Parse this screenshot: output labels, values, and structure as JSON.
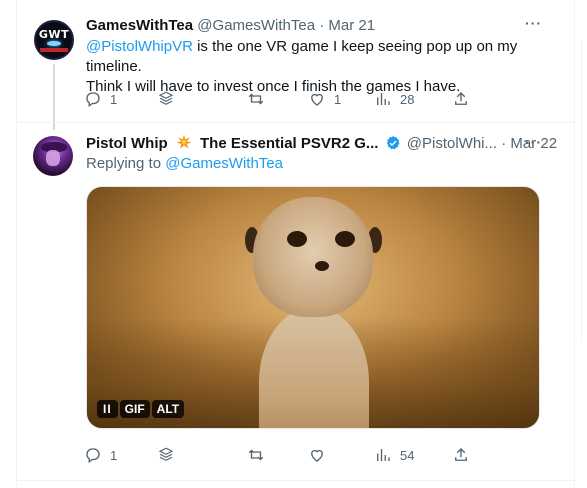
{
  "tweets": [
    {
      "name": "GamesWithTea",
      "handle": "@GamesWithTea",
      "dot": "·",
      "date": "Mar 21",
      "avatar_text": "GWT",
      "mention": "@PistolWhipVR",
      "text_line1_rest": " is the one VR game I keep seeing pop up on my timeline.",
      "text_line2": "Think I will have to invest once I finish the games I have.",
      "actions": {
        "replies": "1",
        "retweets": "",
        "likes": "1",
        "views": "28"
      }
    },
    {
      "name": "Pistol Whip",
      "name_suffix": "The Essential PSVR2 G...",
      "handle": "@PistolWhi...",
      "dot": "·",
      "date": "Mar 22",
      "replying_to_label": "Replying to ",
      "replying_to_handle": "@GamesWithTea",
      "media": {
        "pause": "II",
        "gif": "GIF",
        "alt": "ALT"
      },
      "actions": {
        "replies": "1",
        "retweets": "",
        "likes": "",
        "views": "54"
      }
    }
  ],
  "more_label": "···",
  "colors": {
    "accent": "#1d9bf0",
    "muted": "#536471",
    "text": "#0f1419",
    "divider": "#eff3f4"
  },
  "icons": [
    "reply-icon",
    "stack-icon",
    "retweet-icon",
    "like-icon",
    "views-icon",
    "share-icon",
    "verified-icon",
    "more-icon",
    "collision-emoji-icon"
  ]
}
